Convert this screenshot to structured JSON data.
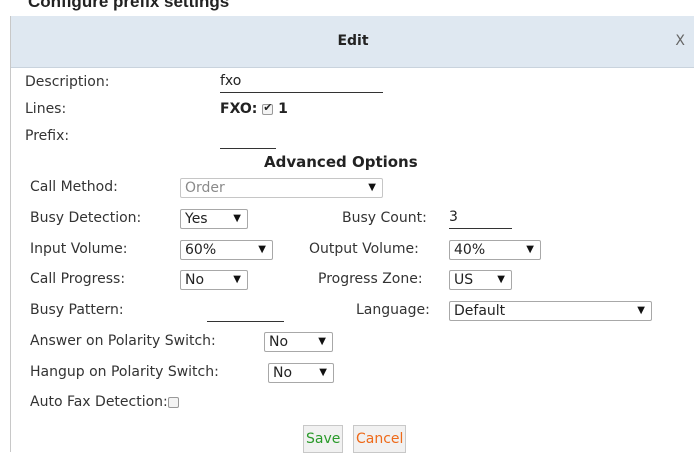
{
  "partial_heading": "Configure prefix settings",
  "dialog": {
    "title": "Edit",
    "close_label": "X"
  },
  "fields": {
    "description_label": "Description:",
    "description_value": "fxo",
    "lines_label": "Lines:",
    "lines_group": "FXO:",
    "lines_checked": true,
    "lines_value": "1",
    "prefix_label": "Prefix:",
    "prefix_value": ""
  },
  "advanced": {
    "heading": "Advanced Options",
    "call_method_label": "Call Method:",
    "call_method_value": "Order",
    "busy_detection_label": "Busy Detection:",
    "busy_detection_value": "Yes",
    "busy_count_label": "Busy Count:",
    "busy_count_value": "3",
    "input_volume_label": "Input Volume:",
    "input_volume_value": "60%",
    "output_volume_label": "Output Volume:",
    "output_volume_value": "40%",
    "call_progress_label": "Call Progress:",
    "call_progress_value": "No",
    "progress_zone_label": "Progress Zone:",
    "progress_zone_value": "US",
    "busy_pattern_label": "Busy Pattern:",
    "busy_pattern_value": "",
    "language_label": "Language:",
    "language_value": "Default",
    "answer_polarity_label": "Answer on Polarity Switch:",
    "answer_polarity_value": "No",
    "hangup_polarity_label": "Hangup on Polarity Switch:",
    "hangup_polarity_value": "No",
    "auto_fax_label": "Auto Fax Detection:",
    "auto_fax_checked": false
  },
  "buttons": {
    "save": "Save",
    "cancel": "Cancel"
  },
  "colors": {
    "titlebar": "#dfe8f1",
    "save_text": "#2a9a2a",
    "cancel_text": "#ee6a1a"
  },
  "icons": {
    "dropdown": "chevron-down-icon",
    "close": "close-icon"
  }
}
